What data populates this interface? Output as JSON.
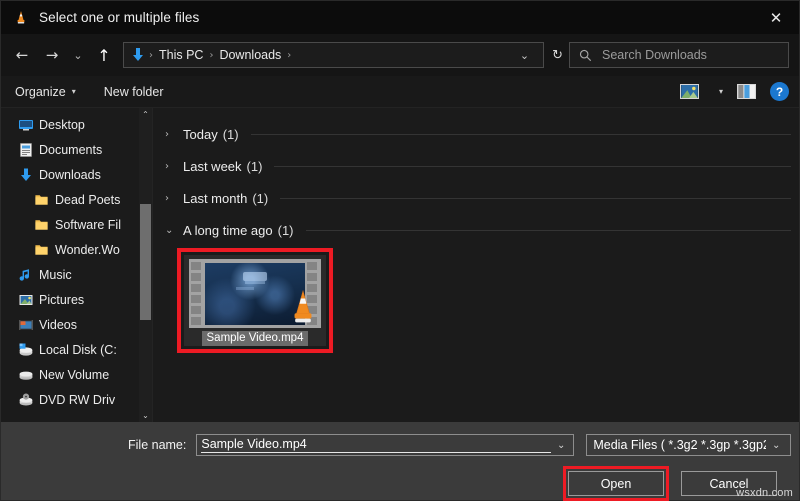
{
  "window": {
    "title": "Select one or multiple files",
    "app_icon": "vlc-cone-icon",
    "close_label": "✕"
  },
  "nav": {
    "back_icon": "←",
    "forward_icon": "→",
    "recent_icon": "⌄",
    "up_icon": "↑",
    "refresh_icon": "↻",
    "dropdown_icon": "⌄",
    "location_icon": "downloads-arrow-icon",
    "breadcrumbs": [
      "This PC",
      "Downloads"
    ],
    "separator": "›"
  },
  "search": {
    "placeholder": "Search Downloads",
    "icon": "search-icon"
  },
  "toolbar": {
    "organize_label": "Organize",
    "organize_caret": "▾",
    "new_folder_label": "New folder",
    "view_icon": "picture-view-icon",
    "view_caret": "▾",
    "preview_pane_icon": "preview-pane-icon",
    "help_label": "?"
  },
  "sidebar": {
    "scroll_up": "⌃",
    "scroll_down": "⌄",
    "items": [
      {
        "label": "Desktop",
        "icon": "desktop-icon",
        "child": false
      },
      {
        "label": "Documents",
        "icon": "documents-icon",
        "child": false
      },
      {
        "label": "Downloads",
        "icon": "downloads-icon",
        "child": false
      },
      {
        "label": "Dead Poets",
        "icon": "folder-icon",
        "child": true
      },
      {
        "label": "Software Fil",
        "icon": "folder-icon",
        "child": true
      },
      {
        "label": "Wonder.Wo",
        "icon": "folder-icon",
        "child": true
      },
      {
        "label": "Music",
        "icon": "music-icon",
        "child": false
      },
      {
        "label": "Pictures",
        "icon": "pictures-icon",
        "child": false
      },
      {
        "label": "Videos",
        "icon": "videos-icon",
        "child": false
      },
      {
        "label": "Local Disk (C:",
        "icon": "local-disk-icon",
        "child": false
      },
      {
        "label": "New Volume",
        "icon": "drive-icon",
        "child": false
      },
      {
        "label": "DVD RW Driv",
        "icon": "dvd-drive-icon",
        "child": false
      }
    ]
  },
  "content": {
    "groups": [
      {
        "title": "Today",
        "count": "(1)",
        "expanded": false,
        "chevron": "›"
      },
      {
        "title": "Last week",
        "count": "(1)",
        "expanded": false,
        "chevron": "›"
      },
      {
        "title": "Last month",
        "count": "(1)",
        "expanded": false,
        "chevron": "›"
      },
      {
        "title": "A long time ago",
        "count": "(1)",
        "expanded": true,
        "chevron": "⌄"
      }
    ],
    "file": {
      "name": "Sample Video.mp4",
      "thumbnail": "video-filmstrip-thumbnail",
      "overlay_icon": "vlc-cone-icon",
      "selected": true,
      "highlight_color": "#ee1b24"
    }
  },
  "footer": {
    "file_name_label": "File name:",
    "file_name_value": "Sample Video.mp4",
    "file_name_caret": "⌄",
    "file_type_value": "Media Files ( *.3g2 *.3gp *.3gp2",
    "file_type_caret": "⌄",
    "open_label": "Open",
    "cancel_label": "Cancel",
    "open_highlight_color": "#ee1b24"
  },
  "watermark": "wsxdn.com"
}
